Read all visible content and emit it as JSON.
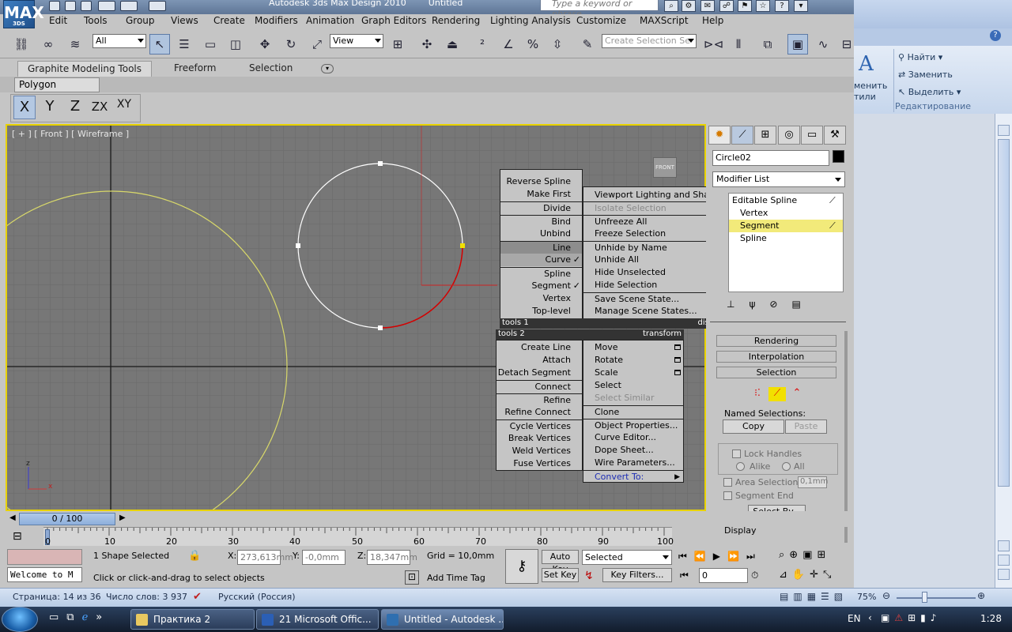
{
  "app": {
    "title": "Autodesk 3ds Max Design 2010",
    "doc": "Untitled",
    "logo": "MAX",
    "logo_sub": "3DS",
    "help_placeholder": "Type a keyword or phrase"
  },
  "menubar": [
    "Edit",
    "Tools",
    "Group",
    "Views",
    "Create",
    "Modifiers",
    "Animation",
    "Graph Editors",
    "Rendering",
    "Lighting Analysis",
    "Customize",
    "MAXScript",
    "Help"
  ],
  "toolbar": {
    "filter": "All",
    "ref_coord": "View",
    "named_sel_placeholder": "Create Selection Se"
  },
  "ribbon": {
    "tabs": [
      "Graphite Modeling Tools",
      "Freeform",
      "Selection"
    ],
    "panel": "Polygon Modeling"
  },
  "axis": [
    "X",
    "Y",
    "Z",
    "ZX",
    "XY"
  ],
  "viewport": {
    "label": "[ + ] [ Front ] [ Wireframe ]",
    "cube_label": "FRONT"
  },
  "quad_menu": {
    "left_top": [
      "Reverse Spline",
      "Make First",
      "Divide",
      "Bind",
      "Unbind",
      "Line",
      "Curve",
      "Spline",
      "Segment",
      "Vertex",
      "Top-level"
    ],
    "checked": [
      "Curve",
      "Segment"
    ],
    "tools1": "tools 1",
    "display": "display",
    "right_top": [
      "Viewport Lighting and Shadows",
      "Isolate Selection",
      "Unfreeze All",
      "Freeze Selection",
      "Unhide by Name",
      "Unhide All",
      "Hide Unselected",
      "Hide Selection",
      "Save Scene State...",
      "Manage Scene States..."
    ],
    "tools2": "tools 2",
    "transform": "transform",
    "left_bottom": [
      "Create Line",
      "Attach",
      "Detach Segment",
      "Connect",
      "Refine",
      "Refine Connect",
      "Cycle Vertices",
      "Break Vertices",
      "Weld Vertices",
      "Fuse Vertices"
    ],
    "right_bottom": [
      "Move",
      "Rotate",
      "Scale",
      "Select",
      "Select Similar",
      "Clone",
      "Object Properties...",
      "Curve Editor...",
      "Dope Sheet...",
      "Wire Parameters...",
      "Convert To:"
    ]
  },
  "command_panel": {
    "object_name": "Circle02",
    "modifier_list": "Modifier List",
    "stack": [
      "Editable Spline",
      "Vertex",
      "Segment",
      "Spline"
    ],
    "rollouts": [
      "Rendering",
      "Interpolation",
      "Selection"
    ],
    "named_selections": "Named Selections:",
    "copy": "Copy",
    "paste": "Paste",
    "lock_handles": "Lock Handles",
    "alike": "Alike",
    "all": "All",
    "area_selection": "Area Selection:",
    "area_value": "0,1mm",
    "segment_end": "Segment End",
    "select_by": "Select By...",
    "display": "Display"
  },
  "timeline": {
    "frame": "0 / 100",
    "ticks": [
      "0",
      "10",
      "20",
      "30",
      "40",
      "50",
      "60",
      "70",
      "80",
      "90",
      "100"
    ]
  },
  "status": {
    "maxscript": "Welcome to M",
    "selection": "1 Shape Selected",
    "prompt": "Click or click-and-drag to select objects",
    "x_label": "X:",
    "x": "273,613mm",
    "y_label": "Y:",
    "y": "-0,0mm",
    "z_label": "Z:",
    "z": "18,347mm",
    "grid": "Grid = 10,0mm",
    "add_time_tag": "Add Time Tag",
    "auto_key": "Auto Key",
    "set_key": "Set Key",
    "selected": "Selected",
    "key_filters": "Key Filters...",
    "frame_field": "0"
  },
  "word": {
    "find": "Найти",
    "replace": "Заменить",
    "select": "Выделить",
    "group": "Редактирование",
    "styles_1": "менить",
    "styles_2": "тили",
    "page": "Страница: 14 из 36",
    "words": "Число слов: 3 937",
    "lang": "Русский (Россия)",
    "zoom": "75%"
  },
  "taskbar": {
    "items": [
      "Практика 2",
      "21 Microsoft Offic...",
      "Untitled - Autodesk ..."
    ],
    "lang": "EN",
    "clock": "1:28"
  },
  "colors": {
    "viewport_bg": "#777777",
    "viewport_border": "#e8d200",
    "selected_segment": "#d40000",
    "circle": "#ffffff",
    "big_circle": "#d8d86a",
    "grid_dark": "#1a1a1a"
  }
}
